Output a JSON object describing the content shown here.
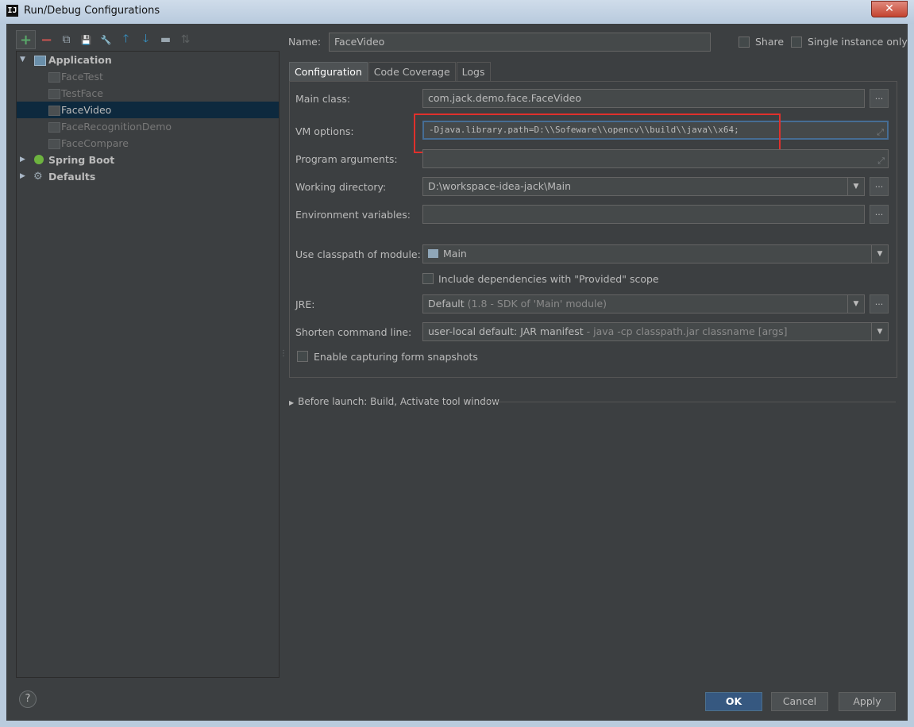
{
  "window": {
    "title": "Run/Debug Configurations",
    "close_glyph": "✕",
    "app_icon_text": "IJ"
  },
  "toolbar": {
    "add": "+",
    "remove": "−",
    "copy": "⧉",
    "save": "💾",
    "edit_defaults": "🔧",
    "move_up": "🡑",
    "move_down": "🡓",
    "folder": "▬",
    "sort": "⇅"
  },
  "tree": {
    "application": {
      "label": "Application",
      "children": [
        "FaceTest",
        "TestFace",
        "FaceVideo",
        "FaceRecognitionDemo",
        "FaceCompare"
      ]
    },
    "spring_boot": "Spring Boot",
    "defaults": "Defaults"
  },
  "name": {
    "label": "Name:",
    "value": "FaceVideo"
  },
  "share": {
    "label": "Share"
  },
  "single_instance": {
    "label": "Single instance only"
  },
  "tabs": [
    "Configuration",
    "Code Coverage",
    "Logs"
  ],
  "config": {
    "main_class": {
      "label": "Main class:",
      "value": "com.jack.demo.face.FaceVideo"
    },
    "vm_options": {
      "label": "VM options:",
      "value": "-Djava.library.path=D:\\\\Sofeware\\\\opencv\\\\build\\\\java\\\\x64;"
    },
    "program_arguments": {
      "label": "Program arguments:",
      "value": ""
    },
    "working_directory": {
      "label": "Working directory:",
      "value": "D:\\workspace-idea-jack\\Main"
    },
    "environment_variables": {
      "label": "Environment variables:",
      "value": ""
    },
    "classpath_module": {
      "label": "Use classpath of module:",
      "value": "Main"
    },
    "include_provided": {
      "label": "Include dependencies with \"Provided\" scope"
    },
    "jre": {
      "label": "JRE:",
      "value": "Default",
      "hint": "(1.8 - SDK of 'Main' module)"
    },
    "shorten_cmd": {
      "label": "Shorten command line:",
      "value": "user-local default: JAR manifest",
      "hint": " - java -cp classpath.jar classname [args]"
    },
    "capture_snapshots": {
      "label": "Enable capturing form snapshots"
    }
  },
  "before_launch": "Before launch: Build, Activate tool window",
  "buttons": {
    "ok": "OK",
    "cancel": "Cancel",
    "apply": "Apply",
    "help": "?",
    "browse": "..."
  }
}
